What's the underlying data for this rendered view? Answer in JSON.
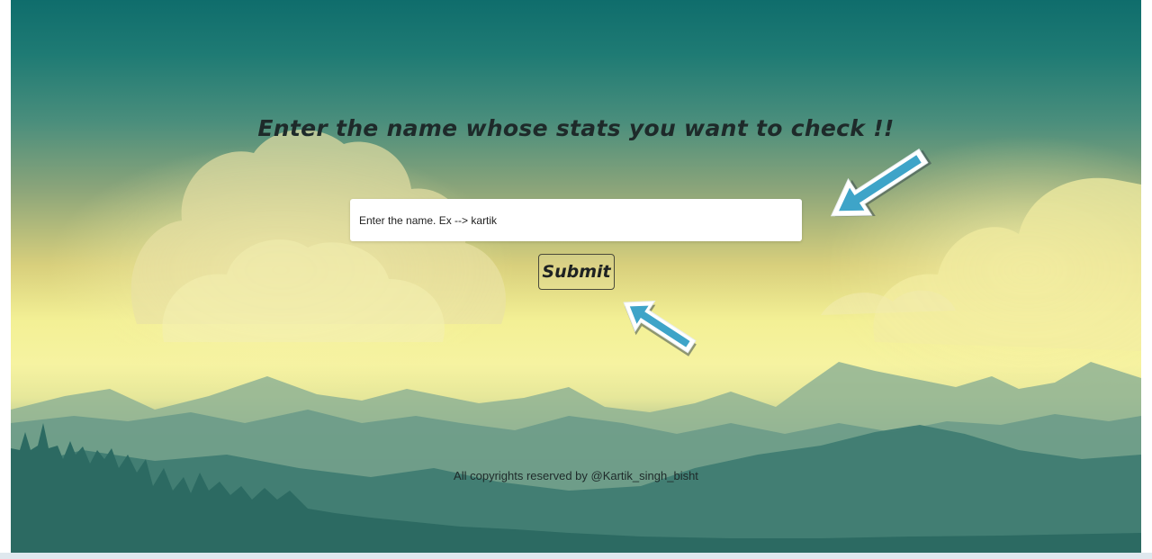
{
  "page": {
    "title": "Enter the name whose stats you want to check !!",
    "footer": "All copyrights reserved by @Kartik_singh_bisht"
  },
  "search": {
    "placeholder": "Enter the name. Ex --> kartik",
    "value": "",
    "submit_label": "Submit"
  },
  "annotations": {
    "arrow_color": "#3ea4c8",
    "arrows": [
      "arrow-pointing-to-input",
      "arrow-pointing-to-submit"
    ]
  },
  "colors": {
    "sky_top": "#0f6d6c",
    "sky_glow": "#f6f3a1",
    "mountain_far": "#8fb394",
    "mountain_near": "#3f7c72",
    "forest": "#2c6a62",
    "text": "#1e2a2a"
  }
}
